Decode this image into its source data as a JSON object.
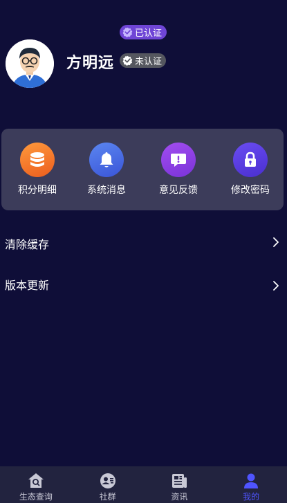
{
  "profile": {
    "name": "方明远",
    "verified_badge": "已认证",
    "unverified_badge": "未认证"
  },
  "quick_actions": [
    {
      "label": "积分明细",
      "icon": "coins-stack-icon",
      "color": "#f07a2a"
    },
    {
      "label": "系统消息",
      "icon": "bell-icon",
      "color": "#4a6fe8"
    },
    {
      "label": "意见反馈",
      "icon": "feedback-message-icon",
      "color": "#8a3fe0"
    },
    {
      "label": "修改密码",
      "icon": "lock-icon",
      "color": "#5a3fe0"
    }
  ],
  "menu": [
    {
      "label": "清除缓存"
    },
    {
      "label": "版本更新"
    }
  ],
  "tabbar": [
    {
      "label": "生态查询",
      "icon": "home-search-icon",
      "active": false
    },
    {
      "label": "社群",
      "icon": "community-icon",
      "active": false
    },
    {
      "label": "资讯",
      "icon": "news-icon",
      "active": false
    },
    {
      "label": "我的",
      "icon": "user-icon",
      "active": true
    }
  ],
  "colors": {
    "background": "#0f0e38",
    "card": "#3c3c5a",
    "tab_active": "#4f54ff",
    "verified_badge": "#6f45d6",
    "unverified_badge": "#55575f"
  }
}
